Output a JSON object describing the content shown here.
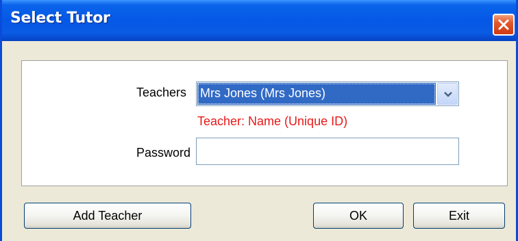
{
  "window": {
    "title": "Select Tutor",
    "close_icon": "close-icon"
  },
  "form": {
    "teachers_label": "Teachers",
    "teachers_selected": "Mrs Jones (Mrs Jones)",
    "hint_text": "Teacher: Name (Unique ID)",
    "password_label": "Password",
    "password_value": ""
  },
  "buttons": {
    "add_teacher": "Add Teacher",
    "ok": "OK",
    "exit": "Exit"
  },
  "colors": {
    "titlebar": "#0558e6",
    "selection": "#316ac5",
    "hint": "#e81818",
    "close": "#e2582c"
  }
}
